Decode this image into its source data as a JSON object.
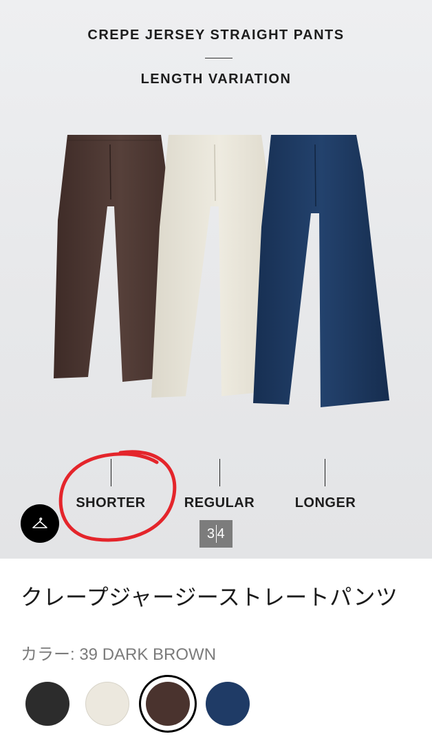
{
  "hero": {
    "title": "CREPE JERSEY STRAIGHT PANTS",
    "subtitle": "LENGTH VARIATION",
    "lengths": [
      "SHORTER",
      "REGULAR",
      "LONGER"
    ],
    "pants_colors": {
      "brown": "#4b342f",
      "cream": "#e9e5d9",
      "navy": "#1d3a62"
    },
    "annotation_color": "#e4252b"
  },
  "gallery": {
    "page_current": "3",
    "page_total": "4",
    "hanger_icon": "hanger-icon"
  },
  "product": {
    "name": "クレープジャージーストレートパンツ",
    "color_label": "カラー: 39 DARK BROWN"
  },
  "swatches": [
    {
      "name": "black",
      "color": "#2c2c2c",
      "selected": false
    },
    {
      "name": "off-white",
      "color": "#ece8de",
      "selected": false
    },
    {
      "name": "dark-brown",
      "color": "#4a332e",
      "selected": true
    },
    {
      "name": "navy",
      "color": "#1f3b66",
      "selected": false
    }
  ]
}
